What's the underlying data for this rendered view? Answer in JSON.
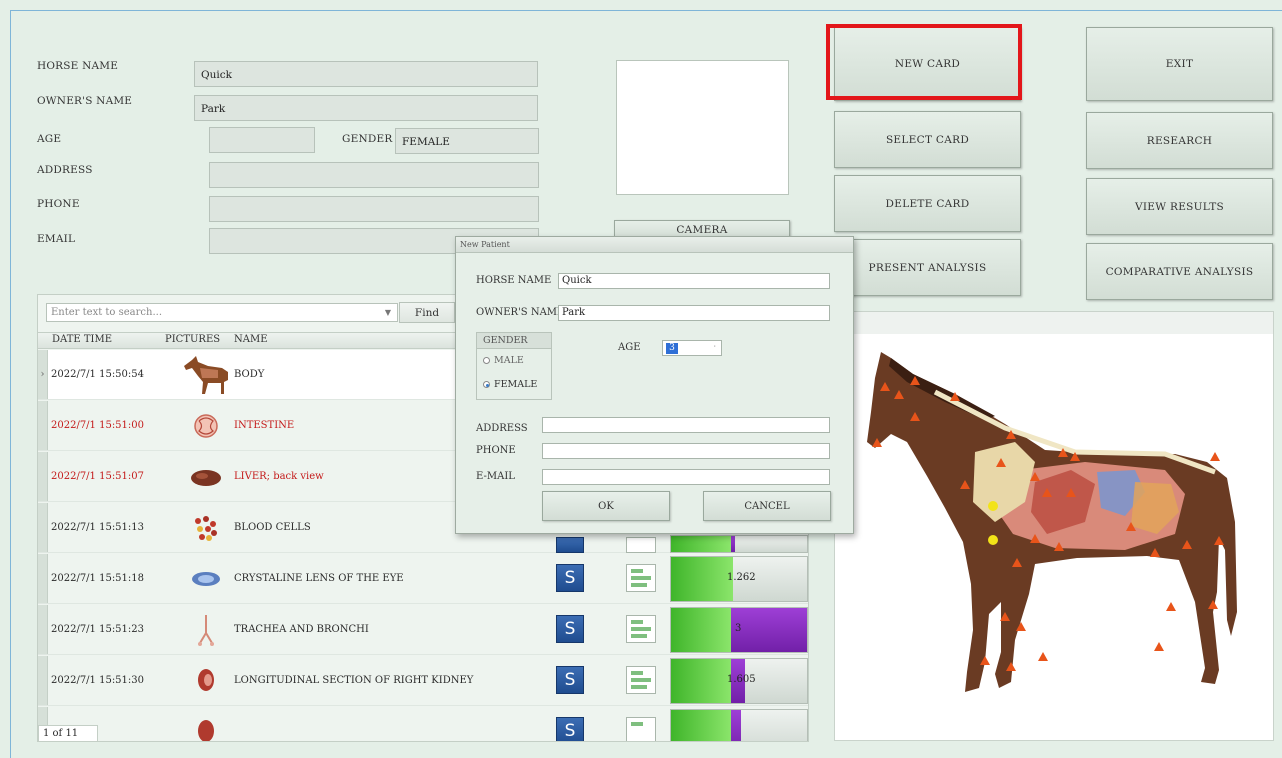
{
  "form": {
    "horse_name_label": "HORSE NAME",
    "horse_name": "Quick",
    "owner_label": "OWNER'S NAME",
    "owner": "Park",
    "age_label": "AGE",
    "age": "",
    "gender_label": "GENDER",
    "gender": "FEMALE",
    "address_label": "ADDRESS",
    "address": "",
    "phone_label": "PHONE",
    "phone": "",
    "email_label": "EMAIL",
    "email": ""
  },
  "camera_label": "CAMERA",
  "buttons": {
    "new_card": "NEW CARD",
    "select_card": "SELECT CARD",
    "delete_card": "DELETE CARD",
    "present_analysis": "PRESENT ANALYSIS",
    "exit": "EXIT",
    "research": "RESEARCH",
    "view_results": "VIEW RESULTS",
    "comparative_analysis": "COMPARATIVE ANALYSIS"
  },
  "grid": {
    "search_placeholder": "Enter text to search...",
    "find_label": "Find",
    "columns": [
      "DATE TIME",
      "PICTURES",
      "NAME"
    ],
    "rows": [
      {
        "datetime": "2022/7/1 15:50:54",
        "name": "BODY",
        "style": "normal",
        "value": ""
      },
      {
        "datetime": "2022/7/1 15:51:00",
        "name": "INTESTINE",
        "style": "red",
        "value": ""
      },
      {
        "datetime": "2022/7/1 15:51:07",
        "name": "LIVER; back view",
        "style": "red",
        "value": ""
      },
      {
        "datetime": "2022/7/1 15:51:13",
        "name": "BLOOD CELLS",
        "style": "normal",
        "value": ""
      },
      {
        "datetime": "2022/7/1 15:51:18",
        "name": "CRYSTALINE LENS OF THE EYE",
        "style": "normal",
        "value": "1.262"
      },
      {
        "datetime": "2022/7/1 15:51:23",
        "name": "TRACHEA AND BRONCHI",
        "style": "normal",
        "value": "3"
      },
      {
        "datetime": "2022/7/1 15:51:30",
        "name": "LONGITUDINAL SECTION OF RIGHT KIDNEY",
        "style": "normal",
        "value": "1.605"
      }
    ],
    "pager": "1 of 11"
  },
  "dialog": {
    "title": "New Patient",
    "horse_name_label": "HORSE NAME",
    "horse_name": "Quick",
    "owner_label": "OWNER'S NAME",
    "owner": "Park",
    "gender_label": "GENDER",
    "male_label": "MALE",
    "female_label": "FEMALE",
    "selected_gender": "FEMALE",
    "age_label": "AGE",
    "age_value": "3",
    "address_label": "ADDRESS",
    "phone_label": "PHONE",
    "email_label": "E-MAIL",
    "ok_label": "OK",
    "cancel_label": "CANCEL"
  },
  "colors": {
    "highlight": "#e3161a",
    "accent_blue": "#1f4c8f",
    "bar_green": "#3fb52a",
    "bar_purple": "#7220a8"
  }
}
